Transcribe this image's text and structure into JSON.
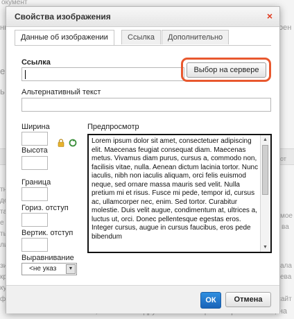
{
  "dialog": {
    "title": "Свойства изображения",
    "close_symbol": "×",
    "tabs": [
      {
        "label": "Данные об изображении",
        "active": true
      },
      {
        "label": "Ссылка",
        "active": false
      },
      {
        "label": "Дополнительно",
        "active": false
      }
    ],
    "url_label": "Ссылка",
    "url_value": "",
    "browse_server_label": "Выбор на сервере",
    "alt_label": "Альтернативный текст",
    "alt_value": "",
    "width_label": "Ширина",
    "height_label": "Высота",
    "border_label": "Граница",
    "hspace_label": "Гориз. отступ",
    "vspace_label": "Вертик. отступ",
    "align_label": "Выравнивание",
    "align_value": "<не указ",
    "preview_label": "Предпросмотр",
    "preview_text": "Lorem ipsum dolor sit amet, consectetuer adipiscing elit. Maecenas feugiat consequat diam. Maecenas metus. Vivamus diam purus, cursus a, commodo non, facilisis vitae, nulla. Aenean dictum lacinia tortor. Nunc iaculis, nibh non iaculis aliquam, orci felis euismod neque, sed ornare massa mauris sed velit. Nulla pretium mi et risus. Fusce mi pede, tempor id, cursus ac, ullamcorper nec, enim. Sed tortor. Curabitur molestie. Duis velit augue, condimentum at, ultrices a, luctus ut, orci. Donec pellentesque egestas eros. Integer cursus, augue in cursus faucibus, eros pede bibendum",
    "ok_label": "ОК",
    "cancel_label": "Отмена"
  },
  "background": {
    "fragments": [
      "окумент",
      "нкта",
      "оен",
      "ент",
      "ь Х",
      "тны",
      "дели",
      "тава",
      "е ру",
      "ть п",
      "лизн",
      "зим",
      "крыв",
      "ку на",
      "фия",
      "ала",
      "ева",
      "сайт",
      "мое",
      "ва",
      "от"
    ],
    "bottom_text": "соблазнительные ссылки, вы можете вдруг вспомнить про интересный сайт, на"
  },
  "colors": {
    "highlight": "#e8582e",
    "ok_button": "#1a63b8",
    "close_icon": "#e03a1e"
  }
}
